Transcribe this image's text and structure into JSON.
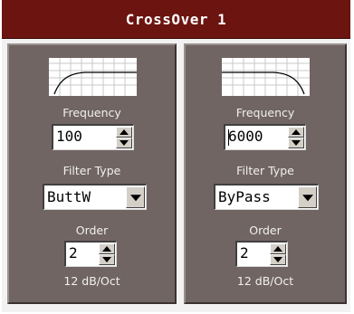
{
  "window": {
    "title": "CrossOver 1"
  },
  "left": {
    "frequency_label": "Frequency",
    "frequency_value": "100",
    "filter_type_label": "Filter Type",
    "filter_type_value": "ButtW",
    "order_label": "Order",
    "order_value": "2",
    "slope_text": "12 dB/Oct",
    "curve": "high-pass-curve-icon"
  },
  "right": {
    "frequency_label": "Frequency",
    "frequency_value": "6000",
    "filter_type_label": "Filter Type",
    "filter_type_value": "ByPass",
    "order_label": "Order",
    "order_value": "2",
    "slope_text": "12 dB/Oct",
    "curve": "low-pass-curve-icon"
  },
  "colors": {
    "titlebar": "#6b1410",
    "panel": "#716563",
    "label_text": "#f0f0f0"
  }
}
